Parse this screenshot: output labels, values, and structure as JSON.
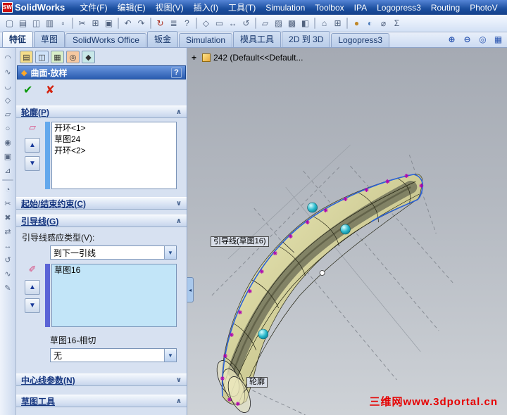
{
  "titlebar": {
    "logo_mark": "SW",
    "logo_text": "SolidWorks",
    "menus": [
      "文件(F)",
      "编辑(E)",
      "视图(V)",
      "插入(I)",
      "工具(T)",
      "Simulation",
      "Toolbox",
      "IPA",
      "Logopress3",
      "Routing",
      "PhotoV"
    ]
  },
  "toolbar": {
    "icons": [
      {
        "name": "new-document-icon",
        "glyph": "▢"
      },
      {
        "name": "open-document-icon",
        "glyph": "▤"
      },
      {
        "name": "save-icon",
        "glyph": "◫"
      },
      {
        "name": "print-icon",
        "glyph": "▥"
      },
      {
        "name": "print-preview-icon",
        "glyph": "▫"
      },
      {
        "sep": true
      },
      {
        "name": "cut-icon",
        "glyph": "✂"
      },
      {
        "name": "copy-icon",
        "glyph": "⊞"
      },
      {
        "name": "paste-icon",
        "glyph": "▣"
      },
      {
        "sep": true
      },
      {
        "name": "undo-icon",
        "glyph": "↶"
      },
      {
        "name": "redo-icon",
        "glyph": "↷"
      },
      {
        "sep": true
      },
      {
        "name": "rebuild-icon",
        "glyph": "↻",
        "color": "#a82818"
      },
      {
        "name": "options-icon",
        "glyph": "≣"
      },
      {
        "name": "help-icon",
        "glyph": "?"
      },
      {
        "sep": true
      },
      {
        "name": "zoom-fit-icon",
        "glyph": "◇"
      },
      {
        "name": "zoom-area-icon",
        "glyph": "▭"
      },
      {
        "name": "pan-icon",
        "glyph": "↔"
      },
      {
        "name": "rotate-view-icon",
        "glyph": "↺"
      },
      {
        "sep": true
      },
      {
        "name": "wireframe-icon",
        "glyph": "▱"
      },
      {
        "name": "hidden-lines-icon",
        "glyph": "▨"
      },
      {
        "name": "shaded-icon",
        "glyph": "▩"
      },
      {
        "name": "section-view-icon",
        "glyph": "◧"
      },
      {
        "sep": true
      },
      {
        "name": "view-orientation-icon",
        "glyph": "⌂"
      },
      {
        "name": "standard-views-icon",
        "glyph": "⊞"
      },
      {
        "sep": true
      },
      {
        "name": "appearance-icon",
        "glyph": "●",
        "color": "#c08828"
      },
      {
        "name": "scene-icon",
        "glyph": "◐",
        "color": "#4878b8"
      },
      {
        "name": "measure-icon",
        "glyph": "⌀"
      },
      {
        "name": "equation-icon",
        "glyph": "Σ"
      }
    ]
  },
  "tabbar": {
    "tabs": [
      {
        "label": "特征",
        "active": true,
        "name": "tab-features"
      },
      {
        "label": "草图",
        "name": "tab-sketch"
      },
      {
        "label": "SolidWorks Office",
        "name": "tab-solidworks-office"
      },
      {
        "label": "钣金",
        "name": "tab-sheet-metal"
      },
      {
        "label": "Simulation",
        "name": "tab-simulation"
      },
      {
        "label": "模具工具",
        "name": "tab-mold-tools"
      },
      {
        "label": "2D 到 3D",
        "name": "tab-2d-to-3d"
      },
      {
        "label": "Logopress3",
        "name": "tab-logopress3"
      }
    ],
    "right_icons": [
      {
        "name": "zoom-in-icon",
        "glyph": "⊕"
      },
      {
        "name": "zoom-out-icon",
        "glyph": "⊖"
      },
      {
        "name": "zoom-selection-icon",
        "glyph": "◎"
      },
      {
        "name": "toolbar-options-icon",
        "glyph": "▦"
      }
    ]
  },
  "side_toolbar": {
    "icons": [
      {
        "name": "extruded-surface-icon",
        "glyph": "◠"
      },
      {
        "name": "revolved-surface-icon",
        "glyph": "∿"
      },
      {
        "name": "swept-surface-icon",
        "glyph": "◡"
      },
      {
        "name": "lofted-surface-icon",
        "glyph": "◇"
      },
      {
        "name": "boundary-surface-icon",
        "glyph": "▱"
      },
      {
        "name": "offset-surface-icon",
        "glyph": "○"
      },
      {
        "name": "knit-surface-icon",
        "glyph": "◉"
      },
      {
        "name": "planar-surface-icon",
        "glyph": "▣"
      },
      {
        "name": "extend-surface-icon",
        "glyph": "⊿"
      },
      {
        "sep": true
      },
      {
        "name": "fillet-icon",
        "glyph": "◔"
      },
      {
        "name": "trim-surface-icon",
        "glyph": "✂"
      },
      {
        "name": "delete-face-icon",
        "glyph": "✖"
      },
      {
        "name": "replace-face-icon",
        "glyph": "⇄"
      },
      {
        "name": "move-surface-icon",
        "glyph": "↔"
      },
      {
        "name": "untrim-surface-icon",
        "glyph": "↺"
      },
      {
        "name": "curve-icon",
        "glyph": "∿"
      },
      {
        "name": "freeform-icon",
        "glyph": "✎"
      }
    ]
  },
  "pm": {
    "tabs": [
      {
        "name": "design-binder-tab-icon",
        "glyph": "▤",
        "bg": "#f5dd8a"
      },
      {
        "name": "property-manager-tab-icon",
        "glyph": "◫",
        "bg": "#cfe2f8"
      },
      {
        "name": "configuration-manager-tab-icon",
        "glyph": "▦",
        "bg": "#d8eec8"
      },
      {
        "name": "dimxpert-tab-icon",
        "glyph": "◎",
        "bg": "#f6c8a0"
      },
      {
        "name": "display-manager-tab-icon",
        "glyph": "◆",
        "bg": "#c8e8e8"
      }
    ],
    "title": "曲面-放样",
    "loft_icon": "◆",
    "help": "?",
    "ok": "✔",
    "cancel": "✘",
    "up_arrow": "▲",
    "down_arrow": "▼",
    "combo_arrow": "▼",
    "profiles": {
      "header": "轮廓(P)",
      "chevron": "∧",
      "selector_icon": "▱",
      "items": [
        "开环<1>",
        "草图24",
        "开环<2>"
      ]
    },
    "constraints": {
      "header": "起始/结束约束(C)",
      "chevron": "∨"
    },
    "guides": {
      "header": "引导线(G)",
      "chevron": "∧",
      "influence_label": "引导线感应类型(V):",
      "influence_value": "到下一引线",
      "selector_icon": "✐",
      "items": [
        "草图16"
      ],
      "tangency_label": "草图16-相切",
      "tangency_value": "无"
    },
    "centerline": {
      "header": "中心线参数(N)",
      "chevron": "∨"
    },
    "sketch_tools": {
      "header": "草图工具",
      "chevron": "∧"
    }
  },
  "viewport": {
    "tree_expand": "+",
    "tree_item": "242 (Default<<Default...",
    "guide_callout": "引导线(草图16)",
    "profile_callout": "轮廓",
    "watermark": "三维网www.3dportal.cn",
    "flyout_handle": "◂"
  },
  "colors": {
    "accent": "#2a5cb0",
    "selection_list": "#c2e5f8",
    "surface_fill": "#cfcc96",
    "edge_blue": "#2b62d9",
    "marker_purple": "#b000b0",
    "sphere_teal": "#18a8c0",
    "watermark_red": "#e60000"
  }
}
